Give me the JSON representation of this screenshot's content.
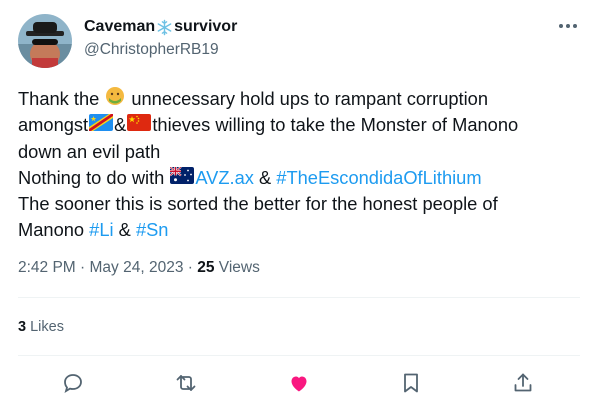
{
  "author": {
    "name_prefix": "Caveman",
    "name_suffix": "survivor",
    "name_emoji": "snowflake-icon",
    "handle": "@ChristopherRB19",
    "avatar": "avatar"
  },
  "tweet": {
    "line1_a": "Thank the",
    "line1_b": "unnecessary hold ups to rampant corruption",
    "line2_a": "amongst",
    "line2_amp": "&",
    "line2_b": "thieves willing to take the Monster of Manono",
    "line3": "down an evil path",
    "line4_a": "Nothing to do with",
    "line4_link": "AVZ.ax",
    "line4_amp": " & ",
    "line4_hashtag": "#TheEscondidaOfLithium",
    "line5": "The sooner this is sorted the better for the honest people of",
    "line6_a": "Manono",
    "line6_tag1": "#Li",
    "line6_amp": " & ",
    "line6_tag2": "#Sn"
  },
  "meta": {
    "time": "2:42 PM",
    "sep1": " · ",
    "date": "May 24, 2023",
    "sep2": " · ",
    "views_count": "25",
    "views_label": " Views"
  },
  "stats": {
    "likes_count": "3",
    "likes_label": " Likes"
  },
  "colors": {
    "link": "#1d9bf0",
    "secondary_text": "#536471",
    "like_active": "#f91880"
  },
  "icons": [
    "more-icon",
    "reply-icon",
    "retweet-icon",
    "like-icon",
    "bookmark-icon",
    "share-icon"
  ]
}
